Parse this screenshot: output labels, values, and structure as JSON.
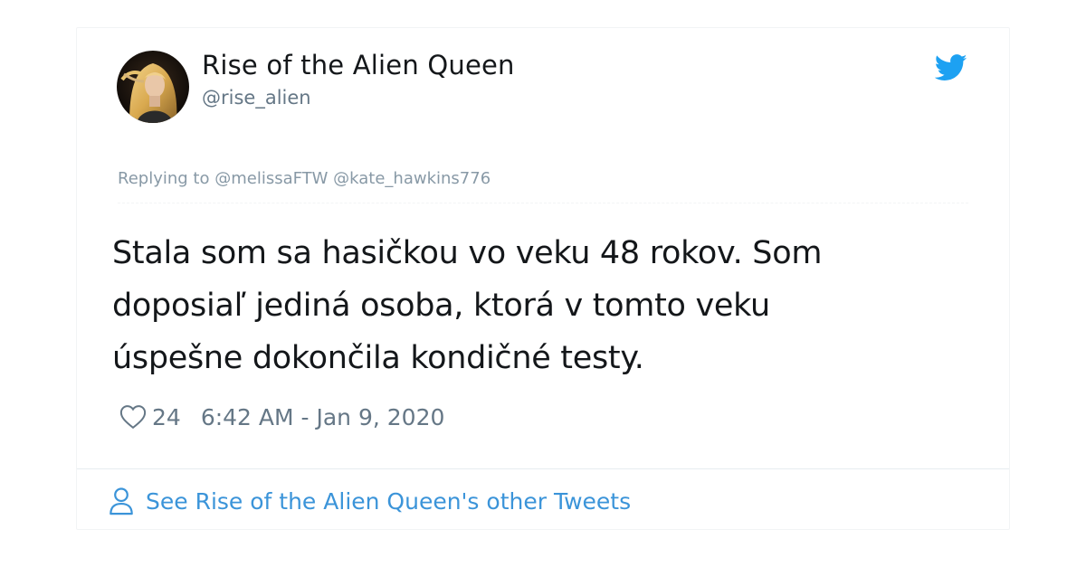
{
  "tweet": {
    "author_name": "Rise of the Alien Queen",
    "author_handle": "@rise_alien",
    "replying_label": "Replying to",
    "reply_mentions": "@melissaFTW @kate_hawkins776",
    "text_lines": [
      "Stala som sa hasičkou vo veku 48 rokov. Som",
      "doposiaľ jediná osoba, ktorá v tomto veku",
      "úspešne dokončila kondičné testy."
    ],
    "like_count": "24",
    "timestamp": "6:42 AM - Jan 9, 2020"
  },
  "footer": {
    "other_tweets_link": "See Rise of the Alien Queen's other Tweets"
  },
  "icons": {
    "brand": "twitter-bird-icon",
    "like": "heart-icon",
    "profile": "person-icon"
  },
  "colors": {
    "brand_blue": "#1da1f2",
    "link_blue": "#3b94d9",
    "text_primary": "#14171a",
    "text_secondary": "#657786",
    "text_muted": "#8899a6"
  }
}
